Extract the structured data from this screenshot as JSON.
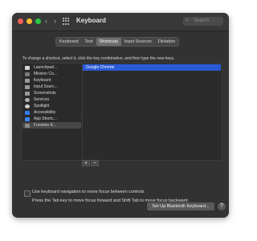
{
  "window": {
    "title": "Keyboard",
    "traffic_lights": {
      "close": "#ff5f57",
      "minimize": "#febc2e",
      "zoom": "#28c840"
    },
    "nav": {
      "back": "‹",
      "forward": "›"
    },
    "search": {
      "placeholder": "Search"
    }
  },
  "tabs": [
    {
      "label": "Keyboard",
      "selected": false
    },
    {
      "label": "Text",
      "selected": false
    },
    {
      "label": "Shortcuts",
      "selected": true
    },
    {
      "label": "Input Sources",
      "selected": false
    },
    {
      "label": "Dictation",
      "selected": false
    }
  ],
  "instruction": "To change a shortcut, select it, click the key combination, and then type the new keys.",
  "categories": [
    {
      "label": "Launchpad...",
      "icon": "launchpad-icon",
      "color": "#d6d6d6"
    },
    {
      "label": "Mission Co...",
      "icon": "mission-control-icon",
      "color": "#7a7a7a"
    },
    {
      "label": "Keyboard",
      "icon": "keyboard-icon",
      "color": "#9a9a9a"
    },
    {
      "label": "Input Sourc...",
      "icon": "input-sources-icon",
      "color": "#9a9a9a"
    },
    {
      "label": "Screenshots",
      "icon": "screenshots-icon",
      "color": "#9a9a9a"
    },
    {
      "label": "Services",
      "icon": "services-icon",
      "color": "#b0b0b0"
    },
    {
      "label": "Spotlight",
      "icon": "spotlight-icon",
      "color": "#cfcfcf"
    },
    {
      "label": "Accessibility",
      "icon": "accessibility-icon",
      "color": "#2f7bf6"
    },
    {
      "label": "App Shortc...",
      "icon": "app-shortcuts-icon",
      "color": "#3a86f7"
    },
    {
      "label": "Function K...",
      "icon": "function-keys-icon",
      "color": "#8a8a8a",
      "selected": true
    }
  ],
  "shortcuts": [
    {
      "label": "Google Chrome",
      "selected": true
    }
  ],
  "controls": {
    "add": "+",
    "remove": "−"
  },
  "keyboard_navigation": {
    "label": "Use keyboard navigation to move focus between controls",
    "checked": false,
    "hint": "Press the Tab key to move focus forward and Shift Tab to move focus backward."
  },
  "buttons": {
    "bluetooth": "Set Up Bluetooth Keyboard...",
    "help": "?"
  },
  "colors": {
    "selection": "#2a5bd6",
    "window_bg": "#323232"
  }
}
